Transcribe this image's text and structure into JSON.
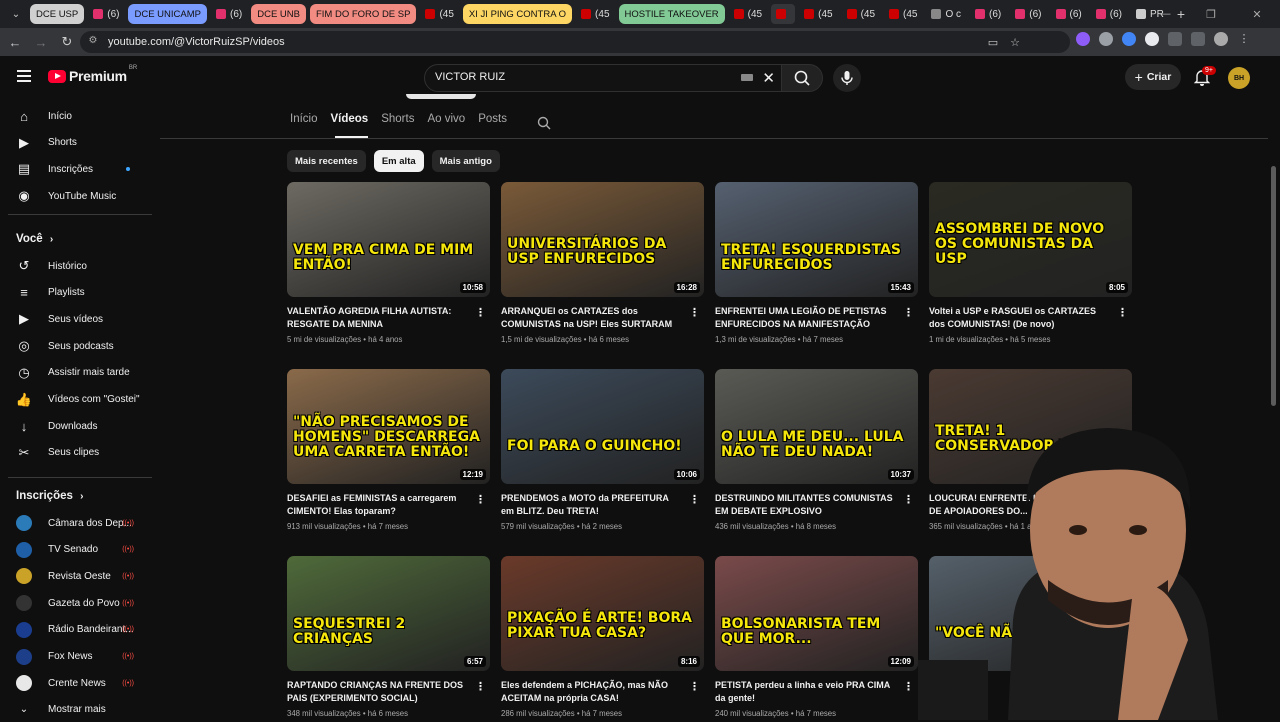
{
  "browser": {
    "tabs": [
      {
        "label": "DCE USP",
        "pill": "#d0d0d0",
        "fav": "#888"
      },
      {
        "label": "(6)",
        "fav": "#e1306c"
      },
      {
        "label": "DCE UNICAMP",
        "pill": "#7a9bff",
        "fav": "#e1306c"
      },
      {
        "label": "(6)",
        "fav": "#e1306c"
      },
      {
        "label": "DCE UNB",
        "pill": "#f28b82",
        "fav": "#e1306c"
      },
      {
        "label": "FIM DO FORO DE SP",
        "pill": "#f28b82",
        "fav": "#cc0000"
      },
      {
        "label": "(45",
        "fav": "#cc0000"
      },
      {
        "label": "XI JI PING CONTRA O",
        "pill": "#fdd663",
        "fav": "#cc0000"
      },
      {
        "label": "(45",
        "fav": "#cc0000"
      },
      {
        "label": "HOSTILE TAKEOVER",
        "pill": "#81c995",
        "fav": "#cc0000"
      },
      {
        "label": "(45",
        "fav": "#cc0000"
      },
      {
        "label": "",
        "fav": "#cc0000",
        "active": true
      },
      {
        "label": "(45",
        "fav": "#cc0000"
      },
      {
        "label": "(45",
        "fav": "#cc0000"
      },
      {
        "label": "(45",
        "fav": "#cc0000"
      },
      {
        "label": "O c",
        "fav": "#888"
      },
      {
        "label": "(6)",
        "fav": "#e1306c"
      },
      {
        "label": "(6)",
        "fav": "#e1306c"
      },
      {
        "label": "(6)",
        "fav": "#e1306c"
      },
      {
        "label": "(6)",
        "fav": "#e1306c"
      },
      {
        "label": "PR",
        "fav": "#ccc"
      }
    ],
    "url": "youtube.com/@VictorRuizSP/videos"
  },
  "header": {
    "logo_text": "Premium",
    "logo_region": "BR",
    "search_value": "VICTOR RUIZ",
    "create_label": "Criar",
    "notif_count": "9+",
    "avatar_text": "BH"
  },
  "sidebar": {
    "main": [
      {
        "label": "Início",
        "icon": "home-icon"
      },
      {
        "label": "Shorts",
        "icon": "shorts-icon"
      },
      {
        "label": "Inscrições",
        "icon": "subscriptions-icon",
        "dot": true
      },
      {
        "label": "YouTube Music",
        "icon": "music-icon"
      }
    ],
    "you_header": "Você",
    "you": [
      {
        "label": "Histórico",
        "icon": "history-icon"
      },
      {
        "label": "Playlists",
        "icon": "playlists-icon"
      },
      {
        "label": "Seus vídeos",
        "icon": "your-videos-icon"
      },
      {
        "label": "Seus podcasts",
        "icon": "podcasts-icon"
      },
      {
        "label": "Assistir mais tarde",
        "icon": "watch-later-icon"
      },
      {
        "label": "Vídeos com \"Gostei\"",
        "icon": "like-icon"
      },
      {
        "label": "Downloads",
        "icon": "download-icon"
      },
      {
        "label": "Seus clipes",
        "icon": "clips-icon"
      }
    ],
    "subs_header": "Inscrições",
    "subs": [
      {
        "label": "Câmara dos Dep...",
        "color": "#2b7bb9"
      },
      {
        "label": "TV Senado",
        "color": "#1f5fa8"
      },
      {
        "label": "Revista Oeste",
        "color": "#c9a227"
      },
      {
        "label": "Gazeta do Povo",
        "color": "#333"
      },
      {
        "label": "Rádio Bandeirant...",
        "color": "#1a3d8f"
      },
      {
        "label": "Fox News",
        "color": "#1d3f8a"
      },
      {
        "label": "Crente News",
        "color": "#e8e8e8"
      }
    ],
    "show_more": "Mostrar mais"
  },
  "channel_tabs": [
    "Início",
    "Vídeos",
    "Shorts",
    "Ao vivo",
    "Posts"
  ],
  "chips": [
    "Mais recentes",
    "Em alta",
    "Mais antigo"
  ],
  "videos": [
    {
      "title": "VALENTÃO AGREDIA FILHA AUTISTA: RESGATE DA MENINA",
      "views": "5 mi de visualizações",
      "age": "há 4 anos",
      "duration": "10:58",
      "caption": "VEM PRA CIMA DE MIM ENTÃO!",
      "bg": "#6d6a62"
    },
    {
      "title": "ARRANQUEI os CARTAZES dos COMUNISTAS na USP! Eles SURTARAM",
      "views": "1,5 mi de visualizações",
      "age": "há 6 meses",
      "duration": "16:28",
      "caption": "UNIVERSITÁRIOS DA USP ENFURECIDOS",
      "bg": "#7a5a38"
    },
    {
      "title": "ENFRENTEI UMA LEGIÃO DE PETISTAS ENFURECIDOS NA MANIFESTAÇÃO \"SEM...",
      "views": "1,3 mi de visualizações",
      "age": "há 7 meses",
      "duration": "15:43",
      "caption": "TRETA! ESQUERDISTAS ENFURECIDOS",
      "bg": "#556070"
    },
    {
      "title": "Voltei a USP e RASGUEI os CARTAZES dos COMUNISTAS! (De novo)",
      "views": "1 mi de visualizações",
      "age": "há 5 meses",
      "duration": "8:05",
      "caption": "ASSOMBREI DE NOVO OS COMUNISTAS DA USP",
      "bg": "#2a2a22"
    },
    {
      "title": "DESAFIEI as FEMINISTAS a carregarem CIMENTO! Elas toparam?",
      "views": "913 mil visualizações",
      "age": "há 7 meses",
      "duration": "12:19",
      "caption": "\"NÃO PRECISAMOS DE HOMENS\" DESCARREGA UMA CARRETA ENTÃO!",
      "bg": "#8a6a4a"
    },
    {
      "title": "PRENDEMOS a MOTO da PREFEITURA em BLITZ. Deu TRETA! @DelegadoPalumbo",
      "views": "579 mil visualizações",
      "age": "há 2 meses",
      "duration": "10:06",
      "caption": "FOI PARA O GUINCHO!",
      "bg": "#3c4a5a"
    },
    {
      "title": "DESTRUINDO MILITANTES COMUNISTAS EM DEBATE EXPLOSIVO",
      "views": "436 mil visualizações",
      "age": "há 8 meses",
      "duration": "10:37",
      "caption": "O LULA ME DEU... LULA NÃO TE DEU NADA!",
      "bg": "#5a5a55"
    },
    {
      "title": "LOUCURA! ENFRENTEI UMA MULTIDÃO DE APOIADORES DO...",
      "views": "365 mil visualizações",
      "age": "há 1 ano",
      "duration": "",
      "caption": "TRETA! 1 CONSERVADOR VS",
      "bg": "#4a3a32"
    },
    {
      "title": "RAPTANDO CRIANÇAS NA FRENTE DOS PAIS (EXPERIMENTO SOCIAL)",
      "views": "348 mil visualizações",
      "age": "há 6 meses",
      "duration": "6:57",
      "caption": "SEQUESTREI 2 CRIANÇAS",
      "bg": "#4f6a3a"
    },
    {
      "title": "Eles defendem a PICHAÇÃO, mas NÃO ACEITAM na própria CASA!",
      "views": "286 mil visualizações",
      "age": "há 7 meses",
      "duration": "8:16",
      "caption": "PIXAÇÃO É ARTE! BORA PIXAR TUA CASA?",
      "bg": "#6a3a2a"
    },
    {
      "title": "PETISTA perdeu a linha e veio PRA CIMA da gente!",
      "views": "240 mil visualizações",
      "age": "há 7 meses",
      "duration": "12:09",
      "caption": "BOLSONARISTA TEM QUE MOR...",
      "bg": "#7a4a4a"
    },
    {
      "title": "",
      "views": "",
      "age": "",
      "duration": "",
      "caption": "\"VOCÊ NÃ",
      "bg": "#55606a"
    }
  ],
  "colors": {
    "accent": "#ff0033",
    "caption": "#f5e60b",
    "background": "#0f0f0f"
  }
}
